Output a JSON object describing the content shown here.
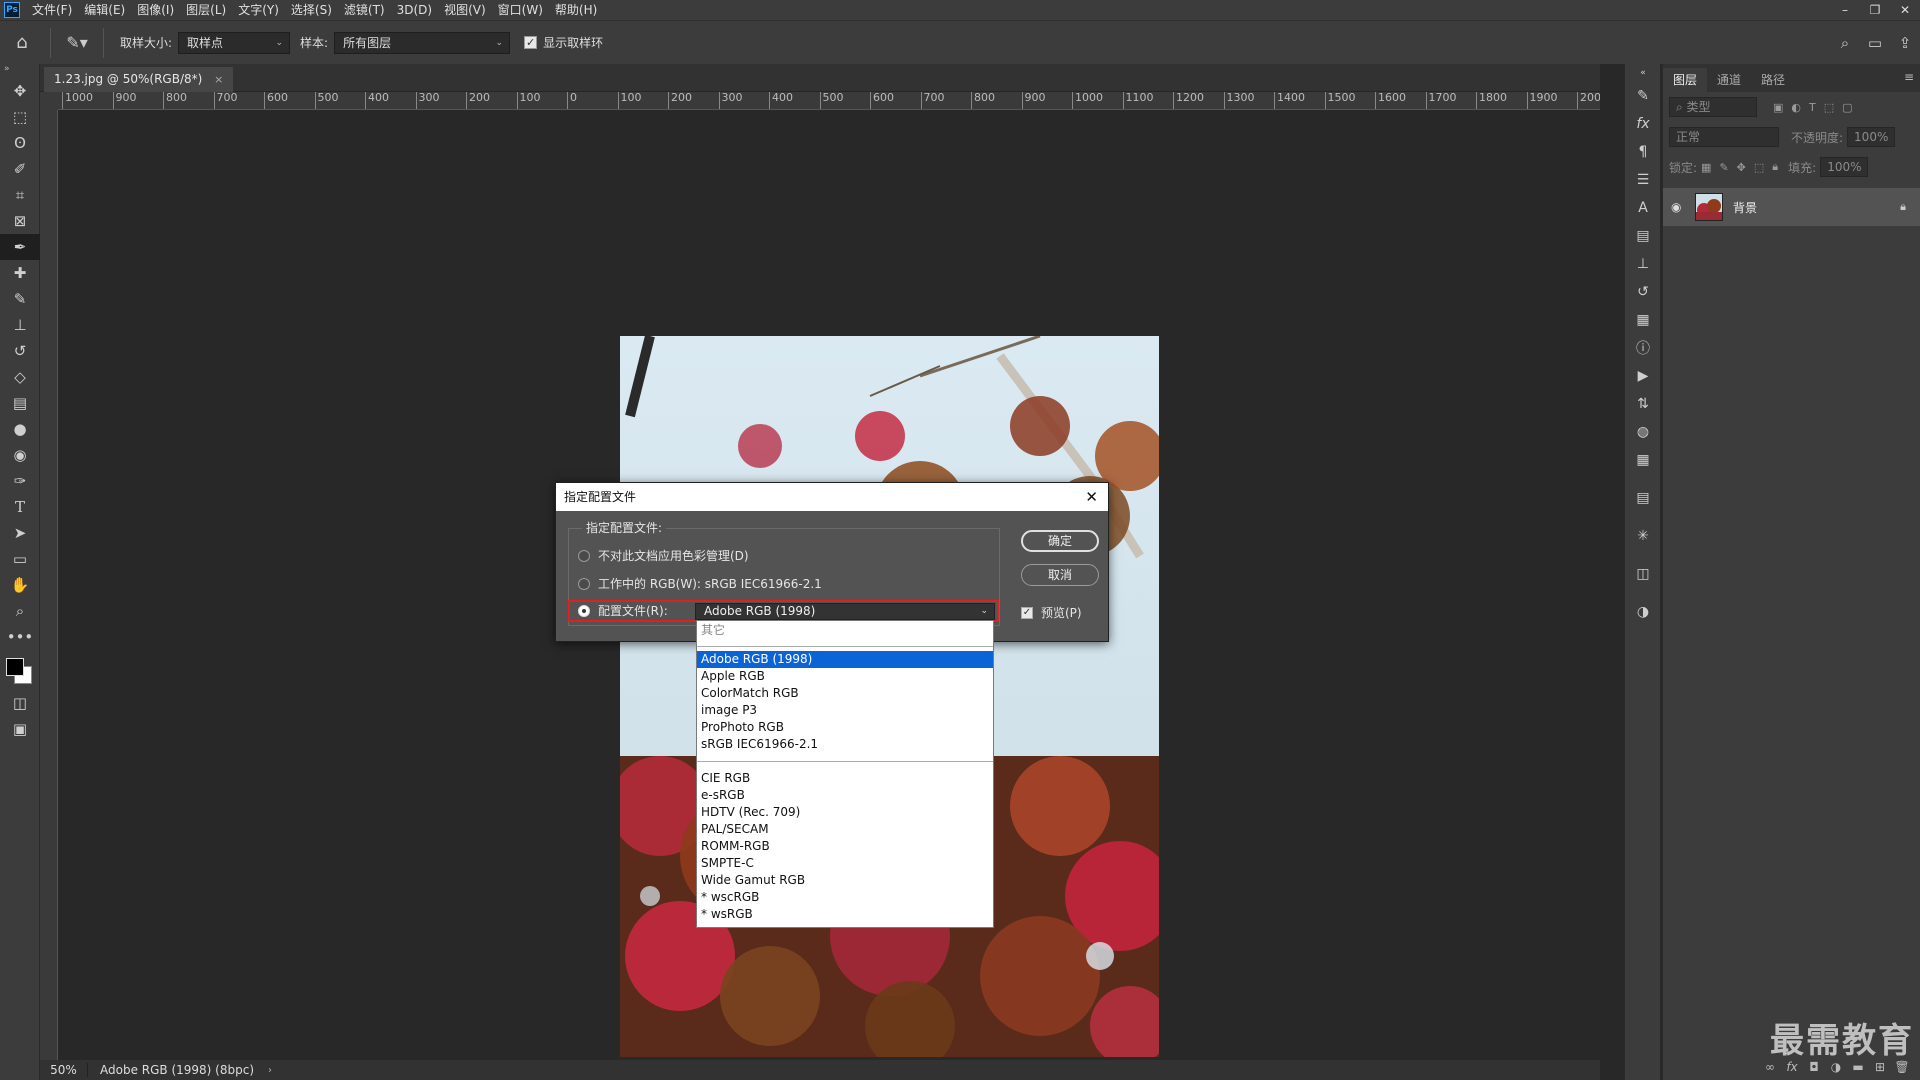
{
  "menubar": {
    "logo": "Ps",
    "items": [
      "文件(F)",
      "编辑(E)",
      "图像(I)",
      "图层(L)",
      "文字(Y)",
      "选择(S)",
      "滤镜(T)",
      "3D(D)",
      "视图(V)",
      "窗口(W)",
      "帮助(H)"
    ]
  },
  "options": {
    "sample_size_label": "取样大小:",
    "sample_size_value": "取样点",
    "sample_label": "样本:",
    "sample_value": "所有图层",
    "show_ring_label": "显示取样环"
  },
  "document": {
    "tab_title": "1.23.jpg @ 50%(RGB/8*)",
    "close_glyph": "×"
  },
  "ruler": {
    "h_ticks": [
      "1000",
      "900",
      "800",
      "700",
      "600",
      "500",
      "400",
      "300",
      "200",
      "100",
      "0",
      "100",
      "200",
      "300",
      "400",
      "500",
      "600",
      "700",
      "800",
      "900",
      "1000",
      "1100",
      "1200",
      "1300",
      "1400",
      "1500",
      "1600",
      "1700",
      "1800",
      "1900",
      "2000"
    ]
  },
  "status": {
    "zoom": "50%",
    "info": "Adobe RGB (1998) (8bpc)",
    "arrow": "›"
  },
  "layers_panel": {
    "tabs": [
      "图层",
      "通道",
      "路径"
    ],
    "kind_placeholder": "类型",
    "blend_mode": "正常",
    "opacity_label": "不透明度:",
    "opacity_value": "100%",
    "lock_label": "锁定:",
    "fill_label": "填充:",
    "fill_value": "100%",
    "layer_name": "背景"
  },
  "watermark": "最需教育",
  "dialog": {
    "title": "指定配置文件",
    "group_label": "指定配置文件:",
    "option_no_manage": "不对此文档应用色彩管理(D)",
    "option_working": "工作中的 RGB(W): sRGB IEC61966-2.1",
    "option_profile": "配置文件(R):",
    "profile_value": "Adobe RGB (1998)",
    "ok_label": "确定",
    "cancel_label": "取消",
    "preview_label": "预览(P)"
  },
  "dropdown": {
    "header": "其它",
    "group1": [
      "Adobe RGB (1998)",
      "Apple RGB",
      "ColorMatch RGB",
      "image P3",
      "ProPhoto RGB",
      "sRGB IEC61966-2.1"
    ],
    "group2": [
      "CIE RGB",
      "e-sRGB",
      "HDTV (Rec. 709)",
      "PAL/SECAM",
      "ROMM-RGB",
      "SMPTE-C",
      "Wide Gamut RGB",
      "* wscRGB",
      "* wsRGB"
    ],
    "selected": "Adobe RGB (1998)"
  },
  "colors": {
    "accent_red": "#e02020",
    "selection_blue": "#0a64d6",
    "ui_dark": "#282828",
    "ui_panel": "#3c3c3c"
  },
  "icons": {
    "tools": [
      "move-icon",
      "marquee-icon",
      "lasso-icon",
      "quick-select-icon",
      "crop-icon",
      "frame-icon",
      "eyedropper-icon",
      "healing-icon",
      "brush-icon",
      "stamp-icon",
      "history-brush-icon",
      "eraser-icon",
      "gradient-icon",
      "blur-icon",
      "dodge-icon",
      "pen-icon",
      "type-icon",
      "path-select-icon",
      "rectangle-icon",
      "hand-icon",
      "zoom-icon",
      "more-icon"
    ]
  }
}
